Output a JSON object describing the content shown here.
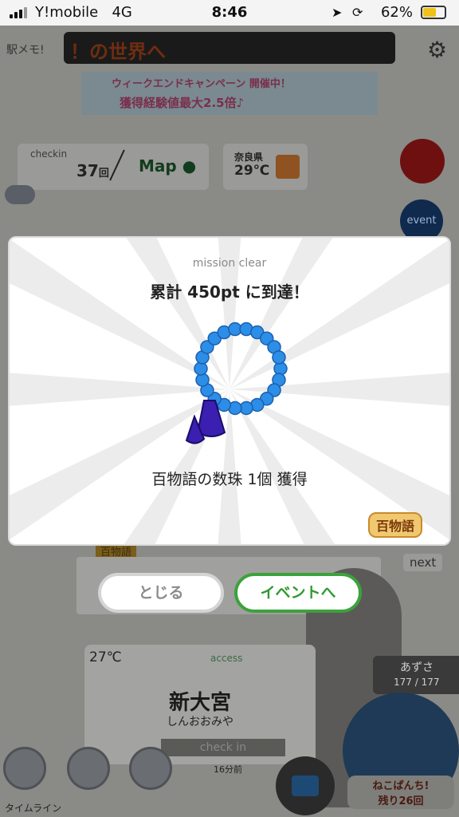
{
  "status_bar": {
    "carrier": "Y!mobile",
    "network": "4G",
    "time": "8:46",
    "battery": "62%"
  },
  "background": {
    "ekimemo_label": "駅メモ!",
    "ticker_text": "！の世界へ",
    "banner_line1": "ウィークエンドキャンペーン 開催中！",
    "banner_line2": "獲得経験値最大2.5倍♪",
    "checkin_label": "checkin",
    "checkin_count": "37",
    "checkin_unit": "回",
    "map_label": "Map",
    "prefecture": "奈良県",
    "temperature": "29℃",
    "event_label": "event",
    "hyakumonogatari_small": "百物語",
    "next_label": "next",
    "station_temp": "27℃",
    "access_label": "access",
    "station_name": "新大宮",
    "station_kana": "しんおおみや",
    "checkin_button": "check in",
    "minutes_ago": "16分前",
    "character_name": "あずさ",
    "character_hp": "177 / 177",
    "nekopanchi_line1": "ねこぱんち!",
    "nekopanchi_line2": "残り26回",
    "timeline_label": "タイムライン"
  },
  "modal": {
    "mission_label": "mission clear",
    "title": "累計 450pt に到達！",
    "reward_text": "百物語の数珠 1個 獲得",
    "logo_text": "百物語",
    "item_icon": "prayer-beads-icon"
  },
  "buttons": {
    "close_label": "とじる",
    "event_label": "イベントへ"
  },
  "colors": {
    "accent_green": "#3ca23c",
    "bead_blue": "#2c8ee6",
    "tassel_purple": "#3a1fb0"
  }
}
